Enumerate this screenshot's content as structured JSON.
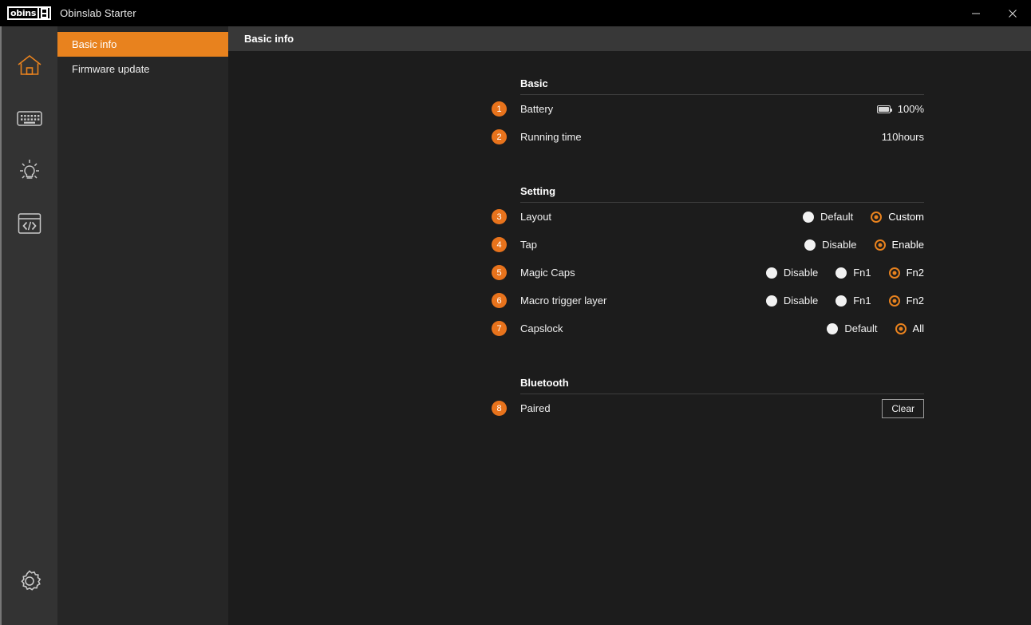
{
  "window": {
    "logo_text": "obins",
    "title": "Obinslab Starter",
    "minimize_label": "–",
    "close_label": "✕"
  },
  "rail": {
    "items": [
      {
        "icon": "home-icon",
        "active": true
      },
      {
        "icon": "keyboard-icon",
        "active": false
      },
      {
        "icon": "lightbulb-icon",
        "active": false
      },
      {
        "icon": "code-icon",
        "active": false
      }
    ],
    "bottom": {
      "icon": "gear-icon"
    }
  },
  "nav": {
    "items": [
      {
        "label": "Basic info",
        "active": true
      },
      {
        "label": "Firmware update",
        "active": false
      }
    ]
  },
  "content": {
    "header_title": "Basic info",
    "sections": [
      {
        "title": "Basic",
        "rows": [
          {
            "number": "1",
            "label": "Battery",
            "type": "battery",
            "value": "100%",
            "fill_percent": 100
          },
          {
            "number": "2",
            "label": "Running time",
            "type": "text",
            "value": "110hours"
          }
        ]
      },
      {
        "title": "Setting",
        "rows": [
          {
            "number": "3",
            "label": "Layout",
            "type": "radio",
            "options": [
              {
                "label": "Default",
                "selected": false
              },
              {
                "label": "Custom",
                "selected": true
              }
            ]
          },
          {
            "number": "4",
            "label": "Tap",
            "type": "radio",
            "options": [
              {
                "label": "Disable",
                "selected": false
              },
              {
                "label": "Enable",
                "selected": true
              }
            ]
          },
          {
            "number": "5",
            "label": "Magic Caps",
            "type": "radio",
            "options": [
              {
                "label": "Disable",
                "selected": false
              },
              {
                "label": "Fn1",
                "selected": false
              },
              {
                "label": "Fn2",
                "selected": true
              }
            ]
          },
          {
            "number": "6",
            "label": "Macro trigger layer",
            "type": "radio",
            "options": [
              {
                "label": "Disable",
                "selected": false
              },
              {
                "label": "Fn1",
                "selected": false
              },
              {
                "label": "Fn2",
                "selected": true
              }
            ]
          },
          {
            "number": "7",
            "label": "Capslock",
            "type": "radio",
            "options": [
              {
                "label": "Default",
                "selected": false
              },
              {
                "label": "All",
                "selected": true
              }
            ]
          }
        ]
      },
      {
        "title": "Bluetooth",
        "rows": [
          {
            "number": "8",
            "label": "Paired",
            "type": "button",
            "button_label": "Clear"
          }
        ]
      }
    ]
  },
  "colors": {
    "accent": "#e8821e",
    "badge": "#e8731c",
    "panel": "#262626",
    "rail": "#333333",
    "content": "#1c1c1c",
    "header": "#383838"
  }
}
